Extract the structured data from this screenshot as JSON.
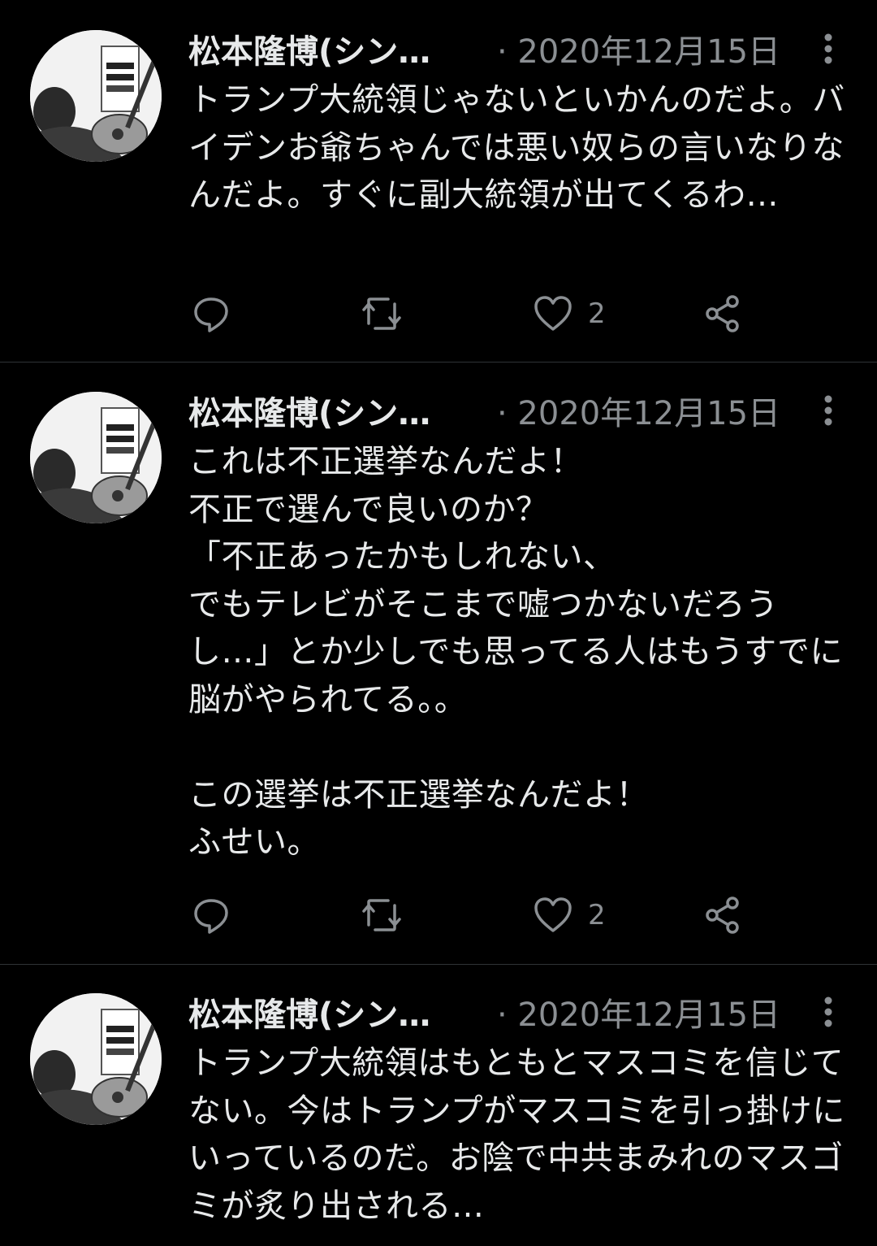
{
  "colors": {
    "background": "#000000",
    "text": "#e7e9ea",
    "secondary": "#8b8f93",
    "divider": "#2f3336"
  },
  "tweets": [
    {
      "author": "松本隆博(シン…",
      "date": "· 2020年12月15日",
      "text": "トランプ大統領じゃないといかんのだよ。バイデンお爺ちゃんでは悪い奴らの言いなりなんだよ。すぐに副大統領が出てくるわ…",
      "like_count": "2",
      "icons": [
        "reply-icon",
        "retweet-icon",
        "heart-icon",
        "share-icon",
        "more-icon"
      ]
    },
    {
      "author": "松本隆博(シン…",
      "date": "· 2020年12月15日",
      "text": "これは不正選挙なんだよ！\n不正で選んで良いのか？\n「不正あったかもしれない、\nでもテレビがそこまで嘘つかないだろうし…」とか少しでも思ってる人はもうすでに脳がやられてる。。\n\nこの選挙は不正選挙なんだよ！\nふせい。",
      "like_count": "2",
      "icons": [
        "reply-icon",
        "retweet-icon",
        "heart-icon",
        "share-icon",
        "more-icon"
      ]
    },
    {
      "author": "松本隆博(シン…",
      "date": "· 2020年12月15日",
      "text": "トランプ大統領はもともとマスコミを信じてない。今はトランプがマスコミを引っ掛けにいっているのだ。お陰で中共まみれのマスゴミが炙り出される…",
      "icons": [
        "more-icon"
      ]
    }
  ]
}
